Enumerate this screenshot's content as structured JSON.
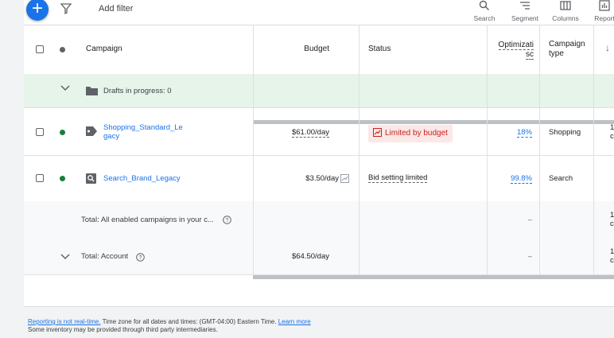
{
  "toolbar": {
    "add_filter": "Add filter",
    "search": "Search",
    "segment": "Segment",
    "columns": "Columns",
    "reports": "Report"
  },
  "columns": {
    "campaign": "Campaign",
    "budget": "Budget",
    "status": "Status",
    "optimization_1": "Optimizati",
    "optimization_2": "sc",
    "campaign_type_1": "Campaign",
    "campaign_type_2": "type"
  },
  "drafts": {
    "label": "Drafts in progress: 0"
  },
  "campaigns": [
    {
      "name_1": "Shopping_Standard_Le",
      "name_2": "gacy",
      "budget": "$61.00/day",
      "status": "Limited by budget",
      "opt_score": "18%",
      "type": "Shopping",
      "extra": "1",
      "extra2": "c"
    },
    {
      "name": "Search_Brand_Legacy",
      "budget": "$3.50/day",
      "status": "Bid setting limited",
      "opt_score": "99.8%",
      "type": "Search"
    }
  ],
  "totals": [
    {
      "label": "Total: All enabled campaigns in your c...",
      "opt": "–",
      "extra": "1",
      "extra2": "c"
    },
    {
      "label": "Total: Account",
      "budget": "$64.50/day",
      "opt": "–",
      "extra": "1",
      "extra2": "c"
    }
  ],
  "footer": {
    "reporting": "Reporting is not real-time.",
    "timezone": " Time zone for all dates and times: (GMT-04:00) Eastern Time. ",
    "learn_more": "Learn more",
    "line2": "Some inventory may be provided through third party intermediaries."
  },
  "colors": {
    "accent": "#1a73e8",
    "enabled_green": "#188038",
    "draft_bg": "#e6f4ea",
    "limited_bg": "#fce8e6"
  }
}
